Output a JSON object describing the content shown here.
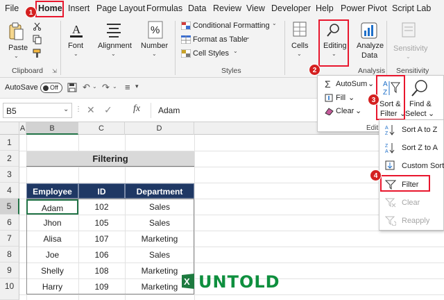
{
  "tabs": [
    "File",
    "Home",
    "Insert",
    "Page Layout",
    "Formulas",
    "Data",
    "Review",
    "View",
    "Developer",
    "Help",
    "Power Pivot",
    "Script Lab"
  ],
  "ribbon": {
    "paste": "Paste",
    "font": "Font",
    "alignment": "Alignment",
    "number": "Number",
    "conditional_formatting": "Conditional Formatting",
    "format_as_table": "Format as Table",
    "cell_styles": "Cell Styles",
    "cells": "Cells",
    "editing": "Editing",
    "analyze_data_1": "Analyze",
    "analyze_data_2": "Data",
    "sensitivity": "Sensitivity",
    "groups": {
      "clipboard": "Clipboard",
      "styles": "Styles",
      "analysis": "Analysis",
      "sensitivity": "Sensitivity"
    }
  },
  "qat": {
    "autosave": "AutoSave",
    "toggle": "Off"
  },
  "formula_bar": {
    "name_box": "B5",
    "fx": "fx",
    "value": "Adam"
  },
  "columns": [
    "A",
    "B",
    "C",
    "D"
  ],
  "rows": [
    "1",
    "2",
    "3",
    "4",
    "5",
    "6",
    "7",
    "8",
    "9",
    "10"
  ],
  "sheet": {
    "title": "Filtering",
    "headers": [
      "Employee",
      "ID",
      "Department"
    ],
    "records": [
      [
        "Adam",
        "102",
        "Sales"
      ],
      [
        "Jhon",
        "105",
        "Sales"
      ],
      [
        "Alisa",
        "107",
        "Marketing"
      ],
      [
        "Joe",
        "106",
        "Sales"
      ],
      [
        "Shelly",
        "108",
        "Marketing"
      ],
      [
        "Harry",
        "109",
        "Marketing"
      ]
    ]
  },
  "editing_menu": {
    "autosum": "AutoSum",
    "fill": "Fill",
    "clear": "Clear",
    "sort_filter_1": "Sort &",
    "sort_filter_2": "Filter",
    "find_select_1": "Find &",
    "find_select_2": "Select",
    "group_label": "Editi"
  },
  "sort_menu": {
    "sort_a_z": "Sort A to Z",
    "sort_z_a": "Sort Z to A",
    "custom_sort": "Custom Sort...",
    "filter": "Filter",
    "clear": "Clear",
    "reapply": "Reapply"
  },
  "steps": [
    "1",
    "2",
    "3",
    "4"
  ],
  "watermark": {
    "prefix": "X",
    "brand": "UNTOLD"
  },
  "colors": {
    "header_fill": "#1f3864",
    "title_fill": "#d9d9d9",
    "highlight": "#e8162d",
    "badge": "#d42020"
  }
}
